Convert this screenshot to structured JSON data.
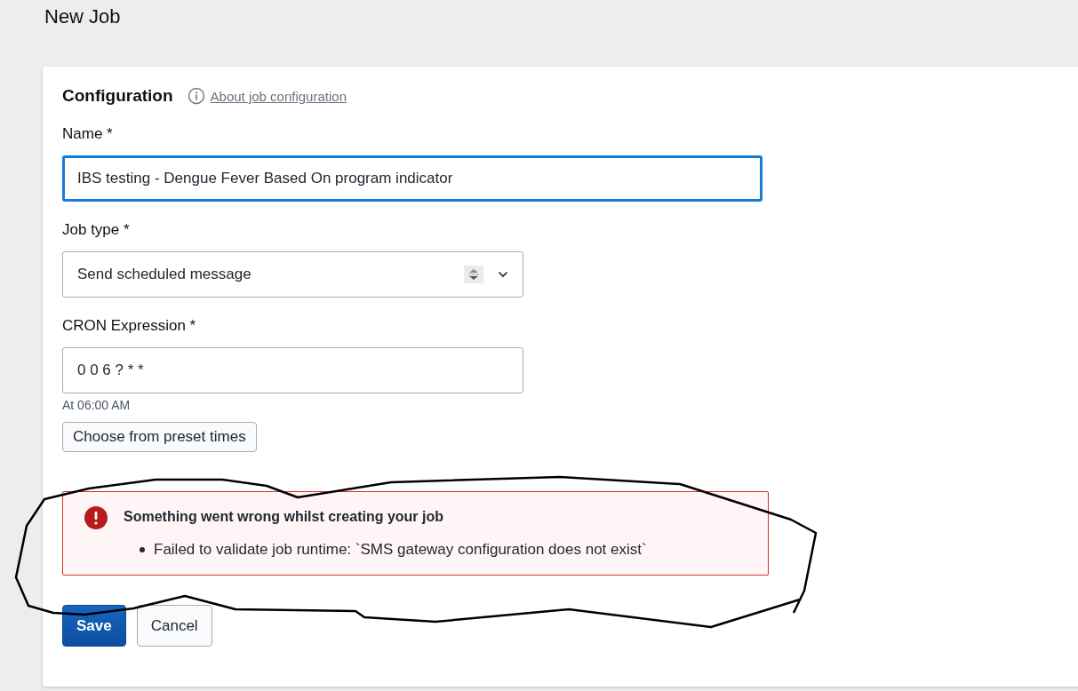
{
  "page_title": "New Job",
  "section": {
    "title": "Configuration",
    "help_link": "About job configuration"
  },
  "fields": [
    {
      "kind": "text",
      "label": "Name *",
      "value": "IBS testing - Dengue Fever Based On program indicator",
      "focused": true
    },
    {
      "kind": "select",
      "label": "Job type *",
      "value": "Send scheduled message",
      "focused": false
    },
    {
      "kind": "text",
      "label": "CRON Expression *",
      "value": "0 0 6 ? * *",
      "focused": false,
      "help": "At 06:00 AM"
    }
  ],
  "preset_button": "Choose from preset times",
  "error": {
    "title": "Something went wrong whilst creating your job",
    "messages": [
      "Failed to validate job runtime: `SMS gateway configuration does not exist`"
    ]
  },
  "buttons": [
    {
      "label": "Save",
      "kind": "primary"
    },
    {
      "label": "Cancel",
      "kind": "secondary"
    }
  ],
  "annotation": {
    "kind": "freehand-loop"
  }
}
